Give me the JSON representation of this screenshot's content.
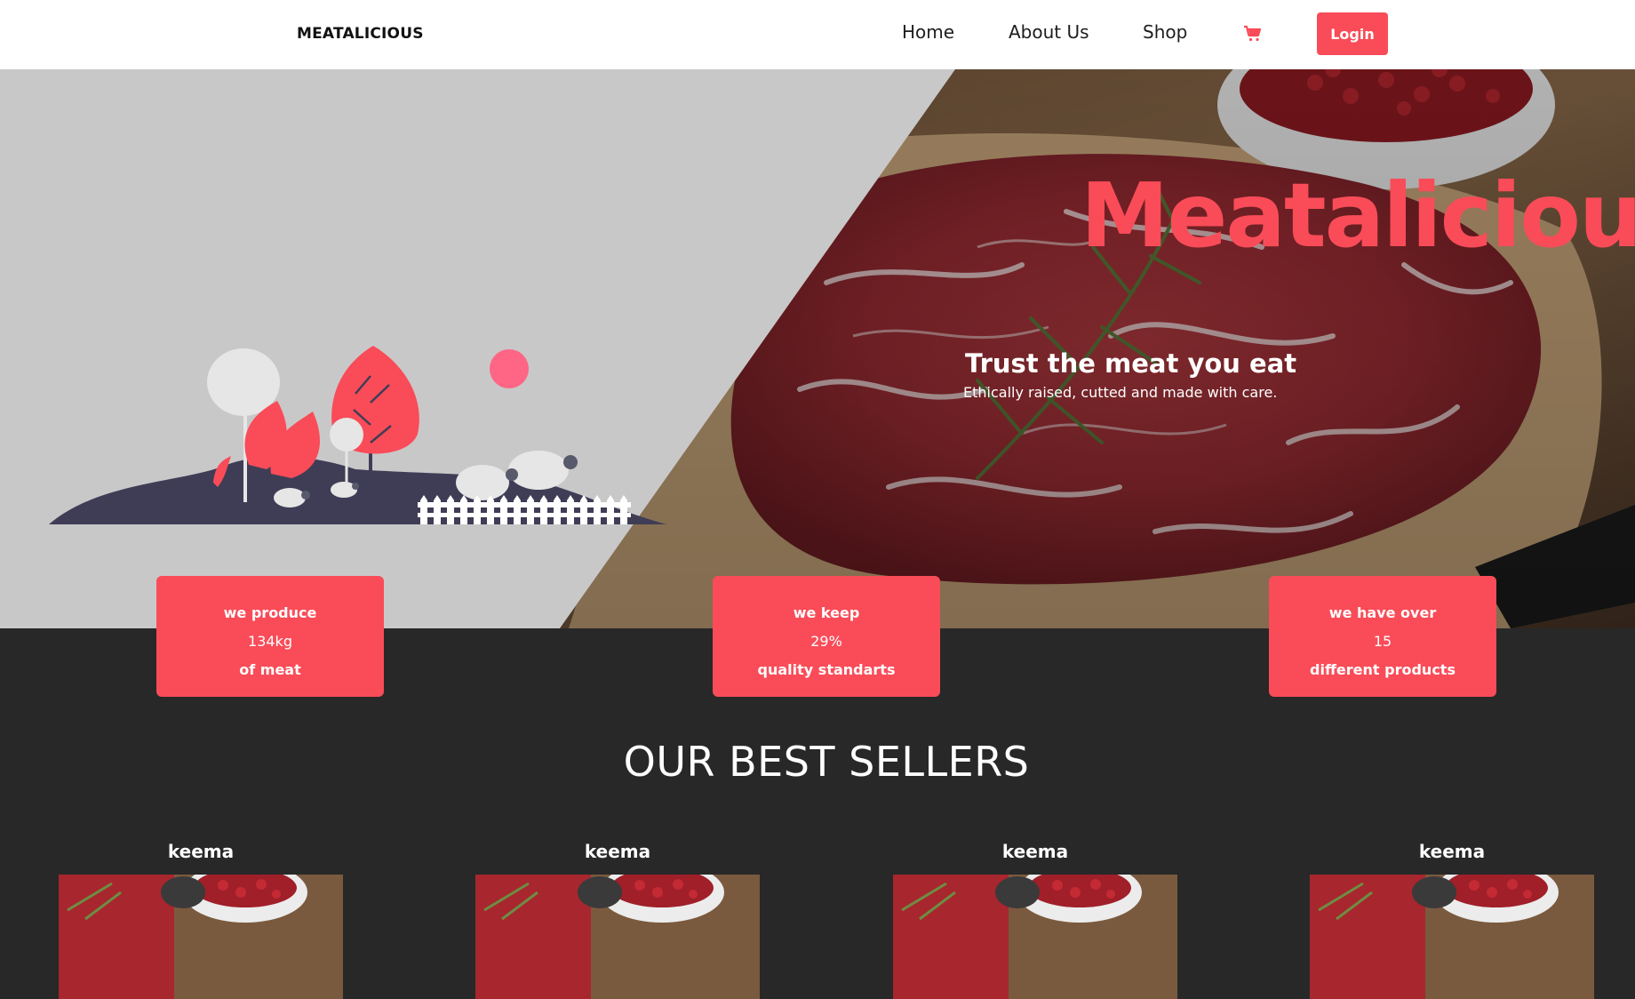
{
  "header": {
    "brand": "MEATALICIOUS",
    "nav": [
      "Home",
      "About Us",
      "Shop"
    ],
    "cart_icon": "cart-icon",
    "login_label": "Login"
  },
  "hero": {
    "title": "Meatalicious",
    "tagline": "Trust the meat you eat",
    "subtitle": "Ethically raised, cutted and made with care."
  },
  "stats": [
    {
      "prefix": "we produce",
      "value": "134kg",
      "suffix": "of meat"
    },
    {
      "prefix": "we keep",
      "value": "29%",
      "suffix": "quality standarts"
    },
    {
      "prefix": "we have over",
      "value": "15",
      "suffix": "different products"
    }
  ],
  "best_sellers": {
    "title": "OUR BEST SELLERS",
    "products": [
      {
        "name": "keema"
      },
      {
        "name": "keema"
      },
      {
        "name": "keema"
      },
      {
        "name": "keema"
      }
    ]
  },
  "colors": {
    "accent": "#f94c58",
    "dark_bg": "#282828",
    "hero_left_bg": "#c9c8c9",
    "illustration_ground": "#3f3d56"
  }
}
